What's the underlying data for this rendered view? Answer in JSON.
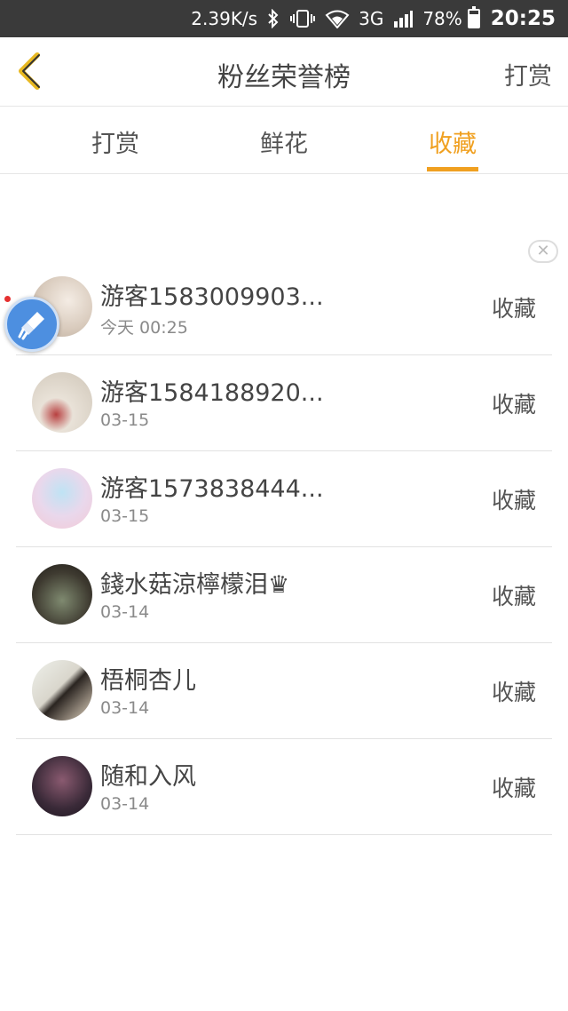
{
  "status_bar": {
    "speed": "2.39K/s",
    "network": "3G",
    "battery": "78%",
    "battery_level": 0.78,
    "time": "20:25"
  },
  "header": {
    "title": "粉丝荣誉榜",
    "right_button": "打赏"
  },
  "tabs": [
    {
      "label": "打赏",
      "active": false
    },
    {
      "label": "鲜花",
      "active": false
    },
    {
      "label": "收藏",
      "active": true
    }
  ],
  "colors": {
    "accent": "#f0a020",
    "status_bar_bg": "#3a3a3a"
  },
  "list": [
    {
      "name": "游客1583009903...",
      "date": "今天 00:25",
      "action": "收藏"
    },
    {
      "name": "游客1584188920...",
      "date": "03-15",
      "action": "收藏"
    },
    {
      "name": "游客1573838444...",
      "date": "03-15",
      "action": "收藏"
    },
    {
      "name": "錢水菇涼檸檬泪♛",
      "date": "03-14",
      "action": "收藏"
    },
    {
      "name": "梧桐杏儿",
      "date": "03-14",
      "action": "收藏"
    },
    {
      "name": "随和入风",
      "date": "03-14",
      "action": "收藏"
    }
  ]
}
